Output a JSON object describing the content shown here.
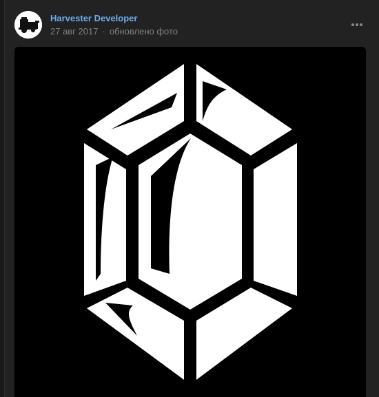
{
  "post": {
    "author": "Harvester Developer",
    "date": "27 авг 2017",
    "separator": "·",
    "action": "обновлено фото"
  },
  "icons": {
    "avatar": "combine-harvester-icon",
    "more": "more-horizontal-icon",
    "photo": "rupee-gem-logo"
  },
  "colors": {
    "background": "#191919",
    "card": "#222222",
    "author_link": "#71aaeb",
    "meta_text": "#828282"
  }
}
